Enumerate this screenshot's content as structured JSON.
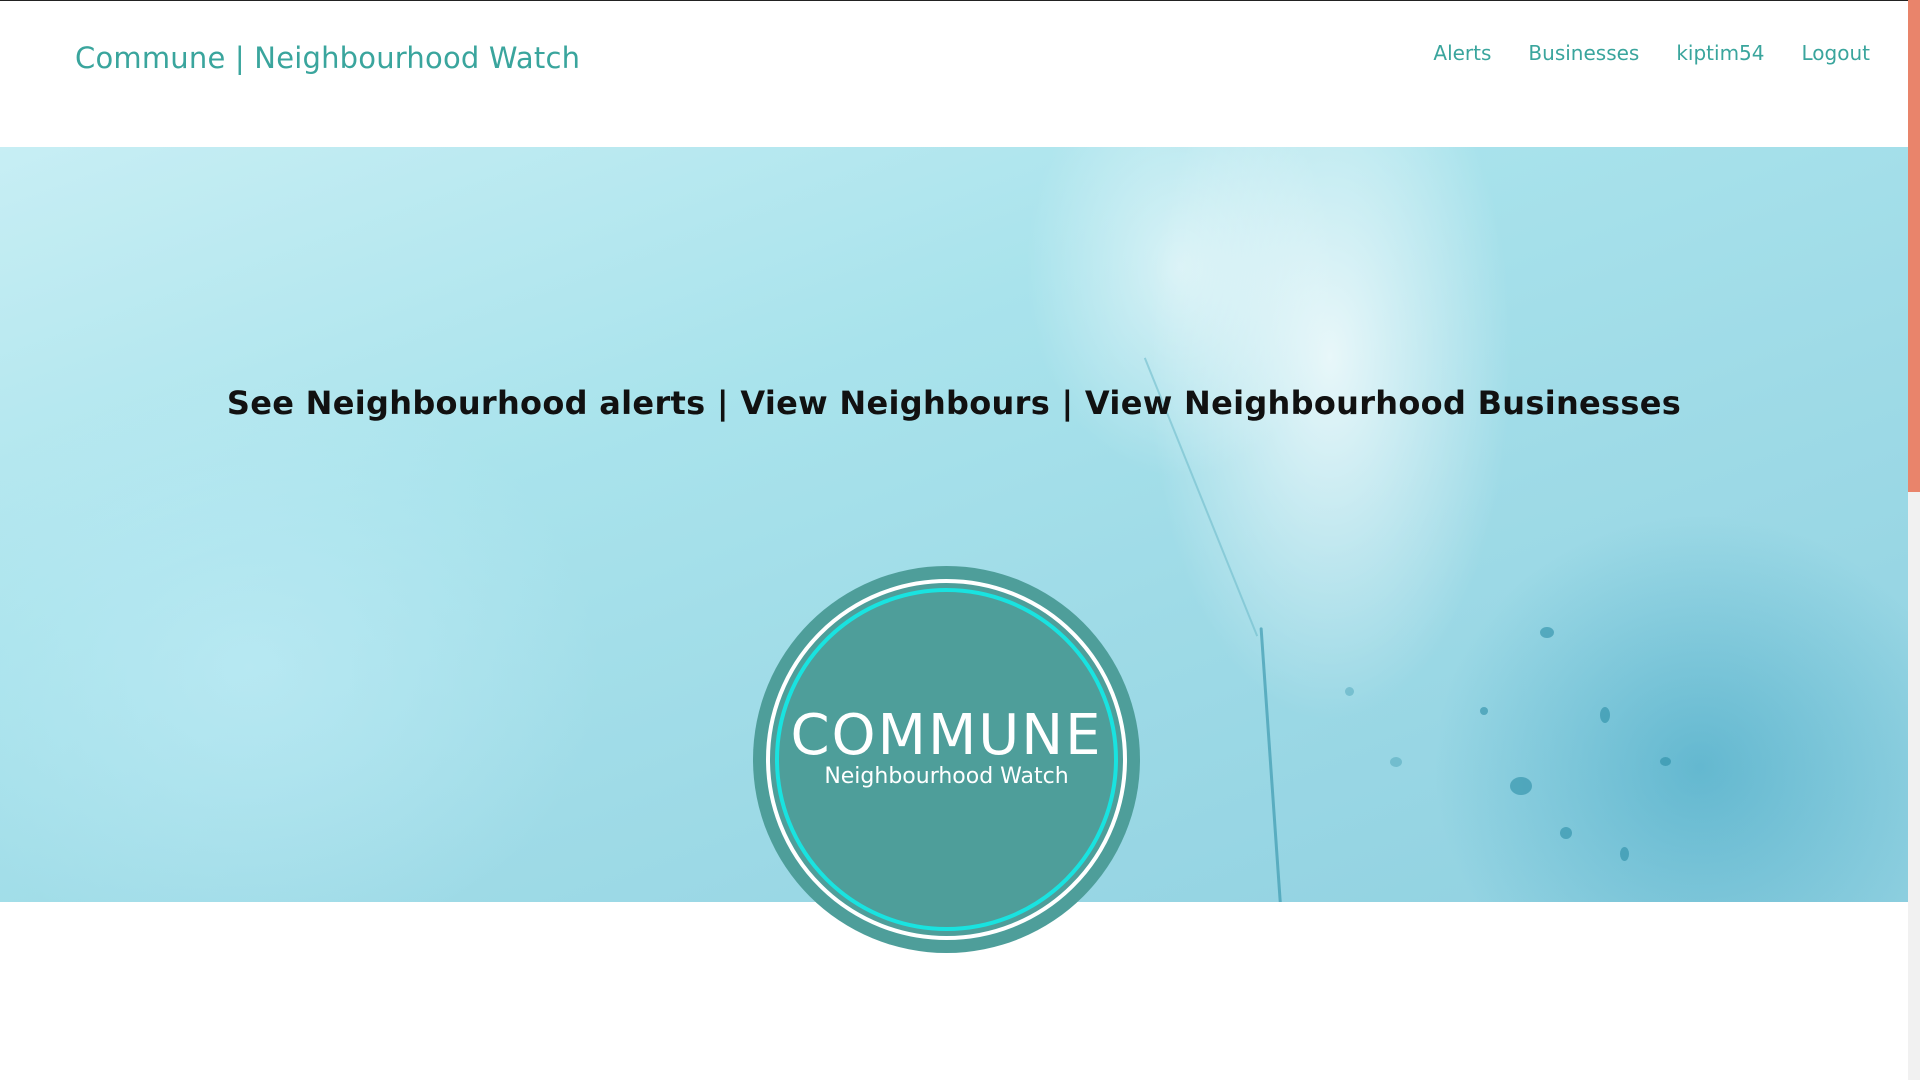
{
  "navbar": {
    "brand": "Commune | Neighbourhood Watch",
    "links": [
      "Alerts",
      "Businesses",
      "kiptim54",
      "Logout"
    ]
  },
  "hero": {
    "headline": "See Neighbourhood alerts | View Neighbours | View Neighbourhood Businesses"
  },
  "logo": {
    "title": "COMMUNE",
    "subtitle": "Neighbourhood Watch"
  },
  "colors": {
    "accent": "#3aa59d",
    "logo_fill": "#4e9e9a",
    "logo_ring_inner": "#19e3e0",
    "scrollbar_thumb": "#e9846b"
  },
  "scroll": {
    "position_fraction": 0
  }
}
